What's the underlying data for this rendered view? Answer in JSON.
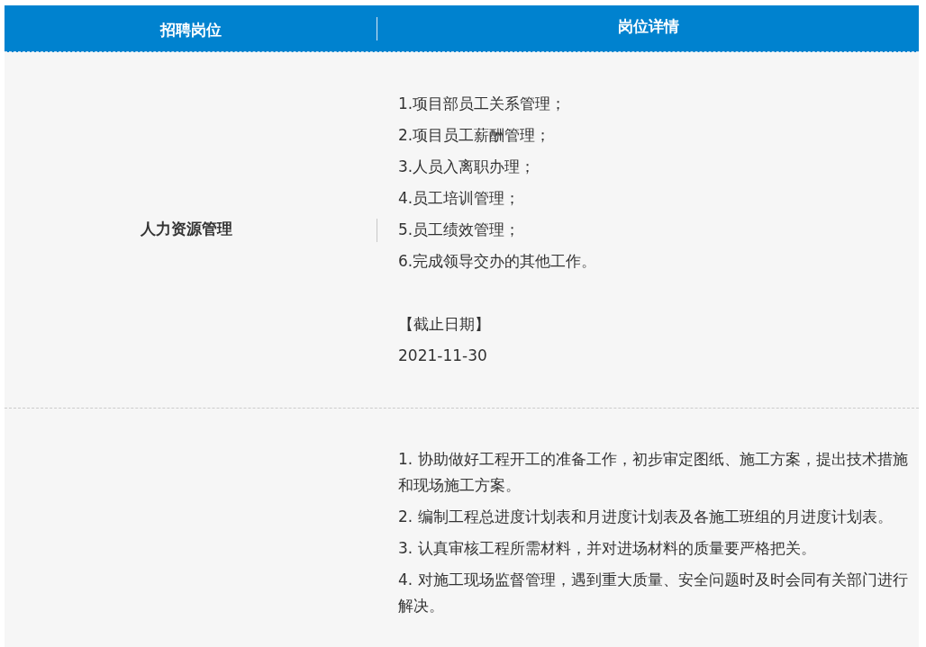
{
  "table": {
    "columns": [
      "招聘岗位",
      "岗位详情"
    ],
    "rows": [
      {
        "position": "人力资源管理",
        "duties": [
          "1.项目部员工关系管理；",
          "2.项目员工薪酬管理；",
          "3.人员入离职办理；",
          "4.员工培训管理；",
          "5.员工绩效管理；",
          "6.完成领导交办的其他工作。"
        ],
        "deadline_label": "【截止日期】",
        "deadline": "2021-11-30"
      },
      {
        "duties": [
          "1. 协助做好工程开工的准备工作，初步审定图纸、施工方案，提出技术措施和现场施工方案。",
          "2. 编制工程总进度计划表和月进度计划表及各施工班组的月进度计划表。",
          "3. 认真审核工程所需材料，并对进场材料的质量要严格把关。",
          "4. 对施工现场监督管理，遇到重大质量、安全问题时及时会同有关部门进行解决。"
        ]
      }
    ]
  }
}
